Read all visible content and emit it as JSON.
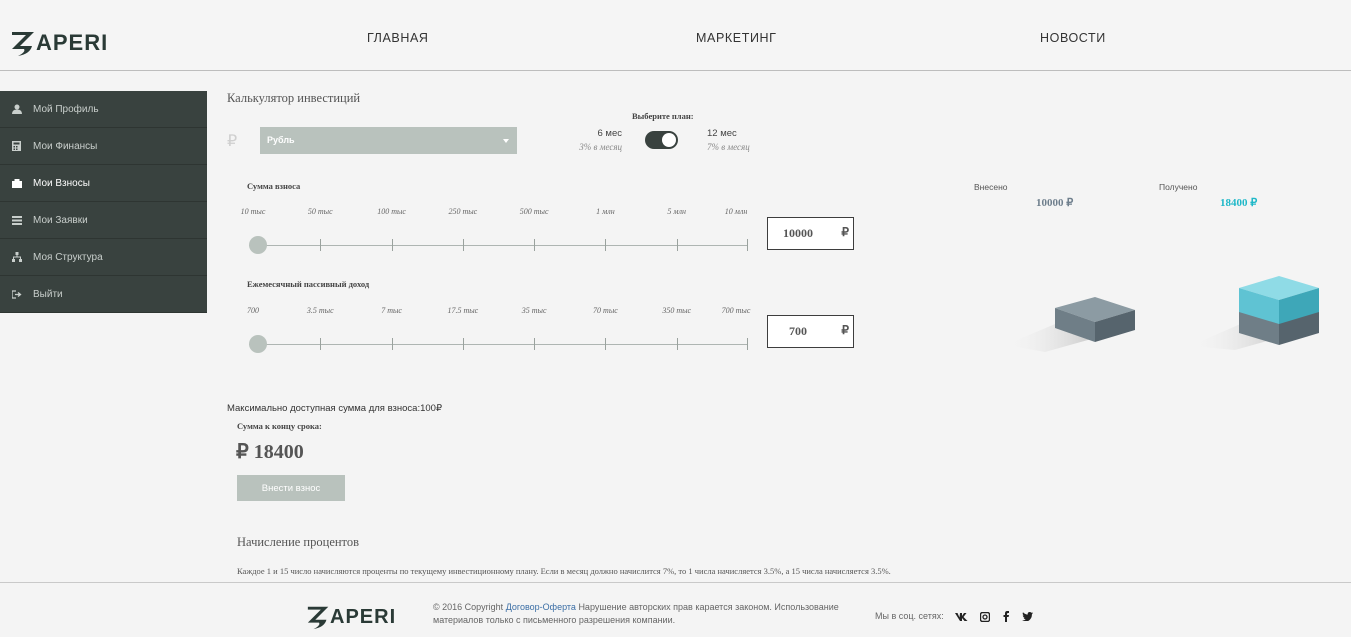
{
  "header": {
    "logo_text": "APERI",
    "nav": [
      "ГЛАВНАЯ",
      "МАРКЕТИНГ",
      "НОВОСТИ"
    ]
  },
  "sidebar": {
    "items": [
      {
        "label": "Мой Профиль",
        "icon": "user-icon"
      },
      {
        "label": "Мои Финансы",
        "icon": "calculator-icon"
      },
      {
        "label": "Мои Взносы",
        "icon": "briefcase-icon",
        "active": true
      },
      {
        "label": "Мои Заявки",
        "icon": "list-icon"
      },
      {
        "label": "Моя Структура",
        "icon": "sitemap-icon"
      },
      {
        "label": "Выйти",
        "icon": "sign-out-icon"
      }
    ]
  },
  "calculator": {
    "title": "Калькулятор инвестиций",
    "currency_symbol": "₽",
    "currency_value": "Рубль",
    "plan_prompt": "Выберите план:",
    "plan_a": {
      "name": "6 мес",
      "rate": "3% в месяц"
    },
    "plan_b": {
      "name": "12 мес",
      "rate": "7% в месяц"
    },
    "plan_selected_index": 1,
    "deposit": {
      "label": "Сумма взноса",
      "ticks": [
        "10 тыс",
        "50 тыс",
        "100 тыс",
        "250 тыс",
        "500 тыс",
        "1 млн",
        "5 млн",
        "10 млн"
      ],
      "value": "10000",
      "currency": "₽",
      "slider_fraction": 0
    },
    "income": {
      "label": "Ежемесячный пассивный доход",
      "ticks": [
        "700",
        "3.5 тыс",
        "7 тыс",
        "17.5 тыс",
        "35 тыс",
        "70 тыс",
        "350 тыс",
        "700 тыс"
      ],
      "value": "700",
      "currency": "₽",
      "slider_fraction": 0
    },
    "invested_label": "Внесено",
    "invested_value": "10000 ₽",
    "received_label": "Получено",
    "received_value": "18400 ₽",
    "max_note": "Максимально доступная сумма для взноса:100₽",
    "end_label": "Сумма к концу срока:",
    "end_sum": "₽ 18400",
    "deposit_button": "Внести взнос",
    "interest_title": "Начисление процентов",
    "interest_text": "Каждое 1 и 15 число начисляются проценты по текущему инвестиционному плану. Если в месяц должно начислится 7%, то 1 числа начисляется 3.5%, а 15 числа начисляется 3.5%."
  },
  "colors": {
    "sidebar_bg": "#39423f",
    "accent_cyan": "#20b8c8",
    "invested_color": "#6f7f8d",
    "muted_button": "#b9c2bd"
  },
  "footer": {
    "logo_text": "APERI",
    "copyright_prefix": "© 2016 Copyright",
    "offer_link": "Договор-Оферта",
    "copyright_suffix": "Нарушение авторских прав карается законом. Использование материалов только с письменного разрешения компании.",
    "social_label": "Мы в соц. сетях:",
    "social_icons": [
      "vk-icon",
      "instagram-icon",
      "facebook-icon",
      "twitter-icon"
    ]
  }
}
